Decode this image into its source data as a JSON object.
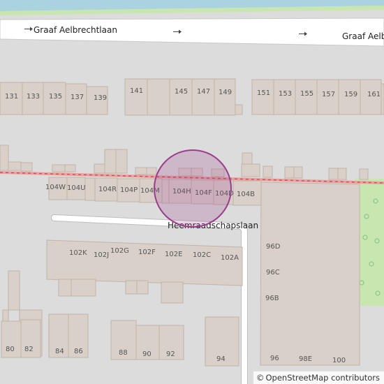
{
  "map": {
    "streets": {
      "top": "Graaf Aelbrechtlaan",
      "middle": "Heemraadschapslaan"
    },
    "buildings": [
      {
        "id": "131",
        "label": "131"
      },
      {
        "id": "133",
        "label": "133"
      },
      {
        "id": "135",
        "label": "135"
      },
      {
        "id": "137",
        "label": "137"
      },
      {
        "id": "139",
        "label": "139"
      },
      {
        "id": "141",
        "label": "141"
      },
      {
        "id": "145",
        "label": "145"
      },
      {
        "id": "147",
        "label": "147"
      },
      {
        "id": "149",
        "label": "149"
      },
      {
        "id": "151",
        "label": "151"
      },
      {
        "id": "153",
        "label": "153"
      },
      {
        "id": "155",
        "label": "155"
      },
      {
        "id": "157",
        "label": "157"
      },
      {
        "id": "159",
        "label": "159"
      },
      {
        "id": "161",
        "label": "161"
      },
      {
        "id": "104W",
        "label": "104W"
      },
      {
        "id": "104U",
        "label": "104U"
      },
      {
        "id": "104R",
        "label": "104R"
      },
      {
        "id": "104P",
        "label": "104P"
      },
      {
        "id": "104M",
        "label": "104M"
      },
      {
        "id": "104H",
        "label": "104H"
      },
      {
        "id": "104F",
        "label": "104F"
      },
      {
        "id": "104D",
        "label": "104D"
      },
      {
        "id": "104B",
        "label": "104B"
      },
      {
        "id": "102K",
        "label": "102K"
      },
      {
        "id": "102J",
        "label": "102J"
      },
      {
        "id": "102G",
        "label": "102G"
      },
      {
        "id": "102F",
        "label": "102F"
      },
      {
        "id": "102E",
        "label": "102E"
      },
      {
        "id": "102C",
        "label": "102C"
      },
      {
        "id": "102A",
        "label": "102A"
      },
      {
        "id": "96D",
        "label": "96D"
      },
      {
        "id": "96C",
        "label": "96C"
      },
      {
        "id": "96B",
        "label": "96B"
      },
      {
        "id": "96",
        "label": "96"
      },
      {
        "id": "98E",
        "label": "98E"
      },
      {
        "id": "100",
        "label": "100"
      },
      {
        "id": "80",
        "label": "80"
      },
      {
        "id": "82",
        "label": "82"
      },
      {
        "id": "84",
        "label": "84"
      },
      {
        "id": "86",
        "label": "86"
      },
      {
        "id": "88",
        "label": "88"
      },
      {
        "id": "90",
        "label": "90"
      },
      {
        "id": "92",
        "label": "92"
      },
      {
        "id": "94",
        "label": "94"
      }
    ],
    "colors": {
      "background": "#dcdcdc",
      "building": "#d9d0c9",
      "road": "#ffffff",
      "water": "#aad3df",
      "park": "#c8e6b0",
      "railway": "#e06060",
      "marker": "#9b3c8c"
    },
    "marker": {
      "type": "circle-highlight"
    }
  },
  "attribution": {
    "symbol": "©",
    "text": "OpenStreetMap contributors"
  }
}
